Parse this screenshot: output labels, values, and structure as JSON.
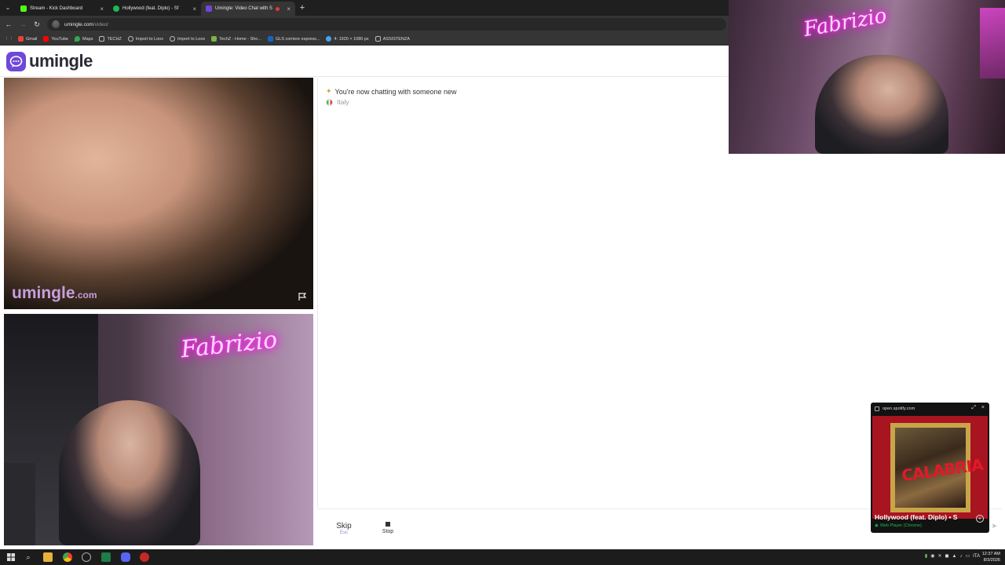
{
  "browser": {
    "tabs": [
      {
        "title": "Stream - Kick Dashboard",
        "icon": "kick-icon",
        "color": "#53fc18"
      },
      {
        "title": "Hollywood (feat. Diplo) - Sf",
        "icon": "spotify-icon",
        "color": "#1db954"
      },
      {
        "title": "Umingle: Video Chat with S",
        "icon": "umingle-icon",
        "color": "#6f48d9"
      }
    ],
    "url_host": "umingle.com",
    "url_path": "/video/",
    "bookmarks": [
      {
        "label": "Gmail",
        "color": "#ea4335"
      },
      {
        "label": "YouTube",
        "color": "#ff0000"
      },
      {
        "label": "Maps",
        "color": "#34a853"
      },
      {
        "label": "TECHZ",
        "color": "#9e9e9e"
      },
      {
        "label": "Import to Loox",
        "color": "#9e9e9e"
      },
      {
        "label": "Import to Loox",
        "color": "#9e9e9e"
      },
      {
        "label": "TechZ - Home - Sho...",
        "color": "#7cb342"
      },
      {
        "label": "GLS corriere espress...",
        "color": "#1565c0"
      },
      {
        "label": "4: 1920 × 1080 px",
        "color": "#42a5f5"
      },
      {
        "label": "ASSISTENZA",
        "color": "#9e9e9e"
      }
    ]
  },
  "site": {
    "logo": "umingle",
    "watermark_main": "umingle",
    "watermark_domain": ".com"
  },
  "chat": {
    "system_message": "You're now chatting with someone new",
    "country": "Italy"
  },
  "controls": {
    "skip_label": "Skip",
    "skip_hint": "Esc",
    "stop_label": "Stop",
    "input_value": ""
  },
  "overlay": {
    "neon_sign": "Fabrizio"
  },
  "spotify": {
    "host": "open.spotify.com",
    "track": "Hollywood (feat. Diplo) • S",
    "device": "Web Player (Chrome)",
    "art_text": "CALABRIA"
  },
  "taskbar": {
    "lang": "ITA",
    "time": "12:37 AM",
    "date": "8/3/2026"
  }
}
